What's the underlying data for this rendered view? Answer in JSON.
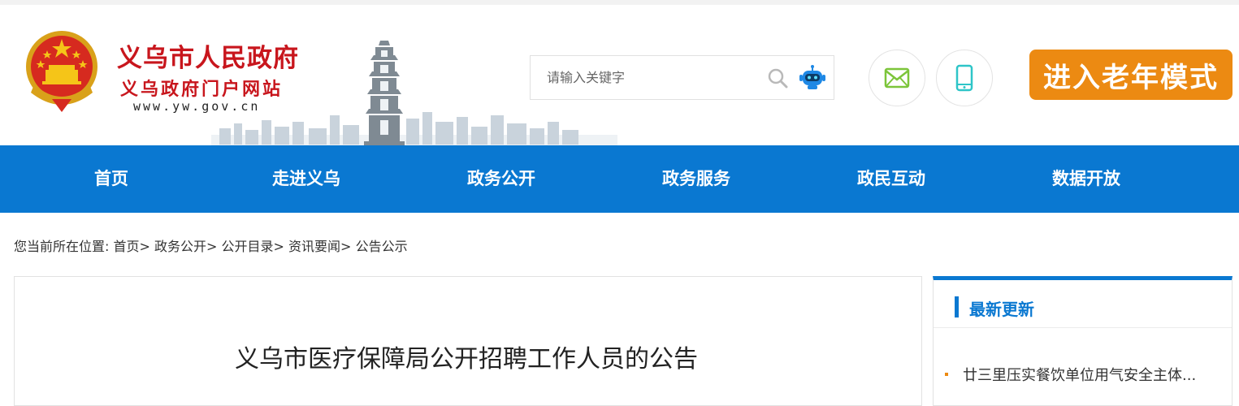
{
  "header": {
    "site_title": "义乌市人民政府",
    "site_subtitle": "义乌政府门户网站",
    "site_url": "www.yw.gov.cn",
    "search_placeholder": "请输入关键字",
    "elder_mode_label": "进入老年模式"
  },
  "icons": {
    "emblem": "national-emblem-icon",
    "search": "search-icon",
    "robot": "robot-assistant-icon",
    "mail": "mail-icon",
    "phone": "mobile-phone-icon"
  },
  "nav": {
    "items": [
      {
        "label": "首页"
      },
      {
        "label": "走进义乌"
      },
      {
        "label": "政务公开"
      },
      {
        "label": "政务服务"
      },
      {
        "label": "政民互动"
      },
      {
        "label": "数据开放"
      }
    ]
  },
  "breadcrumb": {
    "prefix": "您当前所在位置:",
    "items": [
      "首页>",
      "政务公开>",
      "公开目录>",
      "资讯要闻>",
      "公告公示"
    ]
  },
  "article": {
    "title": "义乌市医疗保障局公开招聘工作人员的公告"
  },
  "sidebar": {
    "title": "最新更新",
    "items": [
      {
        "label": "廿三里压实餐饮单位用气安全主体..."
      }
    ]
  },
  "colors": {
    "brand_red": "#c8161d",
    "nav_blue": "#0a78d1",
    "elder_orange": "#ec8a12",
    "mail_green": "#7cc53a",
    "phone_teal": "#2ec5c8"
  }
}
